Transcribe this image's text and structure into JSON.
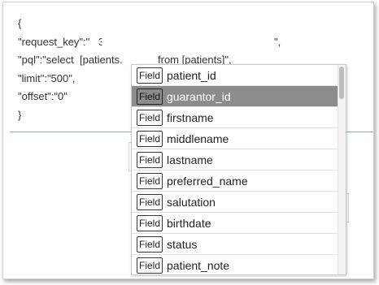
{
  "editor": {
    "open_brace": "{",
    "request_key_label": "\"request_key\":\"",
    "request_key_value_start": "3",
    "request_key_value_end": "\",",
    "pql_label": "\"pql\":\"select  [patients.",
    "pql_tail": "from [patients]\",",
    "limit_line": "\"limit\":\"500\",",
    "offset_line": "\"offset\":\"0\"",
    "close_brace": "}"
  },
  "autocomplete": {
    "badge_label": "Field",
    "selected_index": 1,
    "scroll_position": 0.0,
    "items": [
      {
        "name": "patient_id"
      },
      {
        "name": "guarantor_id"
      },
      {
        "name": "firstname"
      },
      {
        "name": "middlename"
      },
      {
        "name": "lastname"
      },
      {
        "name": "preferred_name"
      },
      {
        "name": "salutation"
      },
      {
        "name": "birthdate"
      },
      {
        "name": "status"
      },
      {
        "name": "patient_note"
      }
    ]
  }
}
